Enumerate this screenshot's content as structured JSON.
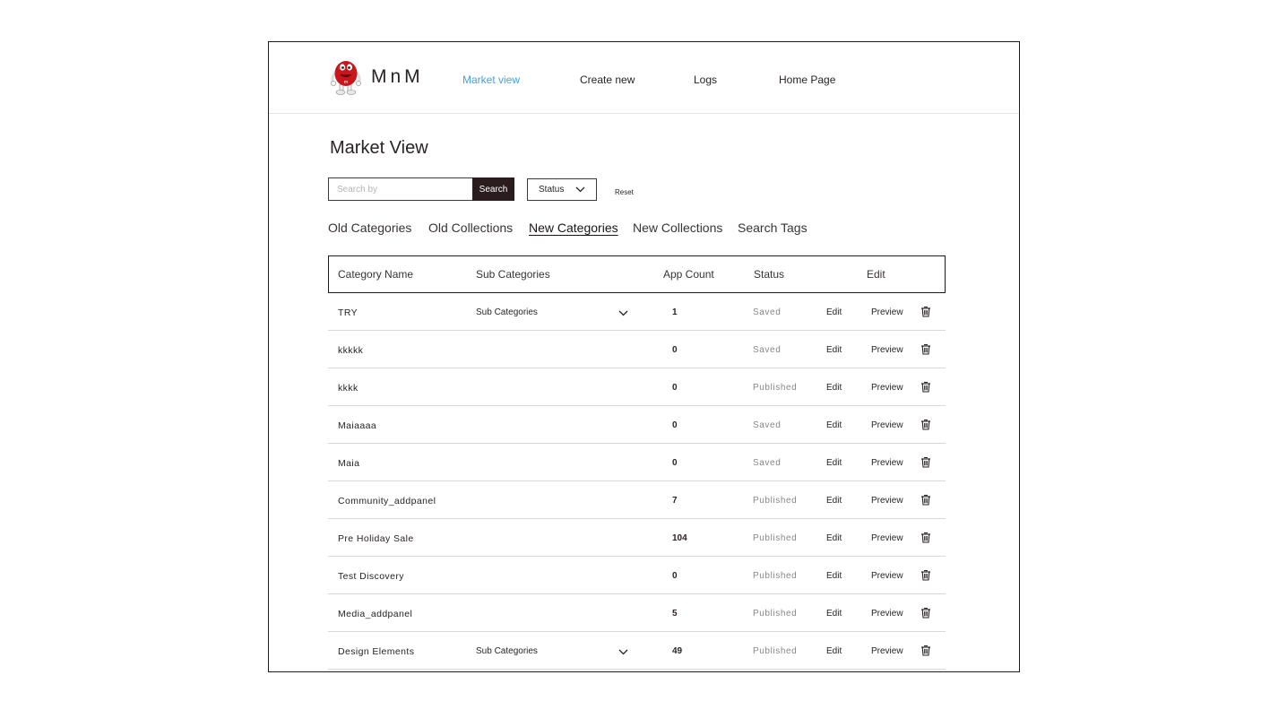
{
  "header": {
    "brand": "MnM",
    "nav": [
      {
        "label": "Market view",
        "active": true
      },
      {
        "label": "Create new",
        "active": false
      },
      {
        "label": "Logs",
        "active": false
      },
      {
        "label": "Home Page",
        "active": false
      }
    ]
  },
  "page": {
    "title": "Market View"
  },
  "filters": {
    "search_placeholder": "Search by",
    "search_value": "",
    "search_button": "Search",
    "status_label": "Status",
    "reset_label": "Reset"
  },
  "tabs": [
    {
      "label": "Old Categories",
      "active": false
    },
    {
      "label": "Old Collections",
      "active": false
    },
    {
      "label": "New Categories",
      "active": true
    },
    {
      "label": "New Collections",
      "active": false
    },
    {
      "label": "Search Tags",
      "active": false
    }
  ],
  "table": {
    "columns": [
      "Category Name",
      "Sub Categories",
      "App Count",
      "Status",
      "Edit"
    ],
    "edit_label": "Edit",
    "preview_label": "Preview",
    "rows": [
      {
        "name": "TRY",
        "sub": "Sub Categories",
        "count": "1",
        "status": "Saved"
      },
      {
        "name": "kkkkk",
        "sub": "",
        "count": "0",
        "status": "Saved"
      },
      {
        "name": "kkkk",
        "sub": "",
        "count": "0",
        "status": "Published"
      },
      {
        "name": "Maiaaaa",
        "sub": "",
        "count": "0",
        "status": "Saved"
      },
      {
        "name": "Maia",
        "sub": "",
        "count": "0",
        "status": "Saved"
      },
      {
        "name": "Community_addpanel",
        "sub": "",
        "count": "7",
        "status": "Published"
      },
      {
        "name": "Pre Holiday Sale",
        "sub": "",
        "count": "104",
        "status": "Published"
      },
      {
        "name": "Test Discovery",
        "sub": "",
        "count": "0",
        "status": "Published"
      },
      {
        "name": "Media_addpanel",
        "sub": "",
        "count": "5",
        "status": "Published"
      },
      {
        "name": "Design Elements",
        "sub": "Sub Categories",
        "count": "49",
        "status": "Published"
      }
    ]
  },
  "colors": {
    "accent": "#4a9fd8",
    "button_dark": "#2b1d1f",
    "logo_red": "#c8161d"
  },
  "icons": {
    "logo": "mascot-logo-icon",
    "select": "chevron-down-icon",
    "delete": "trash-icon"
  }
}
